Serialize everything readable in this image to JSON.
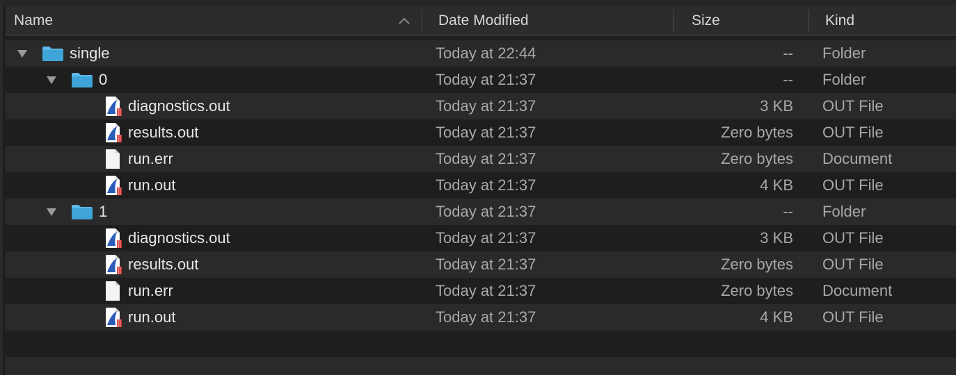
{
  "columns": {
    "name": "Name",
    "date": "Date Modified",
    "size": "Size",
    "kind": "Kind"
  },
  "rows": [
    {
      "name": "single",
      "date": "Today at 22:44",
      "size": "--",
      "kind": "Folder",
      "type": "folder",
      "depth": 0,
      "expanded": true
    },
    {
      "name": "0",
      "date": "Today at 21:37",
      "size": "--",
      "kind": "Folder",
      "type": "folder",
      "depth": 1,
      "expanded": true
    },
    {
      "name": "diagnostics.out",
      "date": "Today at 21:37",
      "size": "3 KB",
      "kind": "OUT File",
      "type": "out",
      "depth": 2
    },
    {
      "name": "results.out",
      "date": "Today at 21:37",
      "size": "Zero bytes",
      "kind": "OUT File",
      "type": "out",
      "depth": 2
    },
    {
      "name": "run.err",
      "date": "Today at 21:37",
      "size": "Zero bytes",
      "kind": "Document",
      "type": "doc",
      "depth": 2
    },
    {
      "name": "run.out",
      "date": "Today at 21:37",
      "size": "4 KB",
      "kind": "OUT File",
      "type": "out",
      "depth": 2
    },
    {
      "name": "1",
      "date": "Today at 21:37",
      "size": "--",
      "kind": "Folder",
      "type": "folder",
      "depth": 1,
      "expanded": true
    },
    {
      "name": "diagnostics.out",
      "date": "Today at 21:37",
      "size": "3 KB",
      "kind": "OUT File",
      "type": "out",
      "depth": 2
    },
    {
      "name": "results.out",
      "date": "Today at 21:37",
      "size": "Zero bytes",
      "kind": "OUT File",
      "type": "out",
      "depth": 2
    },
    {
      "name": "run.err",
      "date": "Today at 21:37",
      "size": "Zero bytes",
      "kind": "Document",
      "type": "doc",
      "depth": 2
    },
    {
      "name": "run.out",
      "date": "Today at 21:37",
      "size": "4 KB",
      "kind": "OUT File",
      "type": "out",
      "depth": 2
    }
  ],
  "icons": {
    "folder": "folder-icon",
    "out": "out-file-icon",
    "doc": "document-icon",
    "sort": "chevron-up-icon",
    "disclosure": "disclosure-triangle-icon"
  },
  "colors": {
    "folder": "#3fa4d8",
    "folder_tab": "#5cb8e6",
    "out_blue": "#2b5db8",
    "out_red": "#d0312d"
  }
}
